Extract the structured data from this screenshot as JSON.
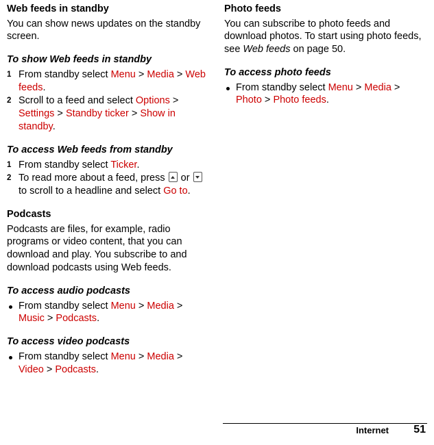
{
  "left_column": {
    "section1": {
      "heading": "Web feeds in standby",
      "body": "You can show news updates on the standby screen."
    },
    "task1": {
      "heading": "To show Web feeds in standby",
      "steps": [
        {
          "num": "1",
          "parts": [
            {
              "t": "From standby select ",
              "s": "plain"
            },
            {
              "t": "Menu",
              "s": "menu"
            },
            {
              "t": " > ",
              "s": "gt"
            },
            {
              "t": "Media",
              "s": "menu"
            },
            {
              "t": " > ",
              "s": "gt"
            },
            {
              "t": "Web feeds",
              "s": "menu"
            },
            {
              "t": ".",
              "s": "plain"
            }
          ]
        },
        {
          "num": "2",
          "parts": [
            {
              "t": "Scroll to a feed and select ",
              "s": "plain"
            },
            {
              "t": "Options",
              "s": "menu"
            },
            {
              "t": " > ",
              "s": "gt"
            },
            {
              "t": "Settings",
              "s": "menu"
            },
            {
              "t": " > ",
              "s": "gt"
            },
            {
              "t": "Standby ticker",
              "s": "menu"
            },
            {
              "t": " > ",
              "s": "gt"
            },
            {
              "t": "Show in standby",
              "s": "menu"
            },
            {
              "t": ".",
              "s": "plain"
            }
          ]
        }
      ]
    },
    "task2": {
      "heading": "To access Web feeds from standby",
      "steps": [
        {
          "num": "1",
          "parts": [
            {
              "t": "From standby select ",
              "s": "plain"
            },
            {
              "t": "Ticker",
              "s": "menu"
            },
            {
              "t": ".",
              "s": "plain"
            }
          ]
        },
        {
          "num": "2",
          "parts": [
            {
              "t": "To read more about a feed, press ",
              "s": "plain"
            },
            {
              "t": "",
              "s": "icon-up"
            },
            {
              "t": " or ",
              "s": "plain"
            },
            {
              "t": "",
              "s": "icon-down"
            },
            {
              "t": " to scroll to a headline and select ",
              "s": "plain"
            },
            {
              "t": "Go to",
              "s": "menu"
            },
            {
              "t": ".",
              "s": "plain"
            }
          ]
        }
      ]
    },
    "section2": {
      "heading": "Podcasts",
      "body": "Podcasts are files, for example, radio programs or video content, that you can download and play. You subscribe to and download podcasts using Web feeds."
    },
    "task3": {
      "heading": "To access audio podcasts",
      "bullets": [
        {
          "parts": [
            {
              "t": "From standby select ",
              "s": "plain"
            },
            {
              "t": "Menu",
              "s": "menu"
            },
            {
              "t": " > ",
              "s": "gt"
            },
            {
              "t": "Media",
              "s": "menu"
            },
            {
              "t": " > ",
              "s": "gt"
            },
            {
              "t": "Music",
              "s": "menu"
            },
            {
              "t": " > ",
              "s": "gt"
            },
            {
              "t": "Podcasts",
              "s": "menu"
            },
            {
              "t": ".",
              "s": "plain"
            }
          ]
        }
      ]
    },
    "task4": {
      "heading": "To access video podcasts",
      "bullets": [
        {
          "parts": [
            {
              "t": "From standby select ",
              "s": "plain"
            },
            {
              "t": "Menu",
              "s": "menu"
            },
            {
              "t": " > ",
              "s": "gt"
            },
            {
              "t": "Media",
              "s": "menu"
            },
            {
              "t": " > ",
              "s": "gt"
            },
            {
              "t": "Video",
              "s": "menu"
            },
            {
              "t": " > ",
              "s": "gt"
            },
            {
              "t": "Podcasts",
              "s": "menu"
            },
            {
              "t": ".",
              "s": "plain"
            }
          ]
        }
      ]
    }
  },
  "right_column": {
    "section1": {
      "heading": "Photo feeds",
      "body_parts": [
        {
          "t": "You can subscribe to photo feeds and download photos. To start using photo feeds, see ",
          "s": "plain"
        },
        {
          "t": "Web feeds",
          "s": "italic"
        },
        {
          "t": " on page 50.",
          "s": "plain"
        }
      ]
    },
    "task1": {
      "heading": "To access photo feeds",
      "bullets": [
        {
          "parts": [
            {
              "t": "From standby select ",
              "s": "plain"
            },
            {
              "t": "Menu",
              "s": "menu"
            },
            {
              "t": " > ",
              "s": "gt"
            },
            {
              "t": "Media",
              "s": "menu"
            },
            {
              "t": " > ",
              "s": "gt"
            },
            {
              "t": "Photo",
              "s": "menu"
            },
            {
              "t": " > ",
              "s": "gt"
            },
            {
              "t": "Photo feeds",
              "s": "menu"
            },
            {
              "t": ".",
              "s": "plain"
            }
          ]
        }
      ]
    }
  },
  "footer": {
    "label": "Internet",
    "page_number": "51"
  },
  "colors": {
    "menu_reference": "#cc0000",
    "text": "#000000",
    "background": "#ffffff"
  }
}
